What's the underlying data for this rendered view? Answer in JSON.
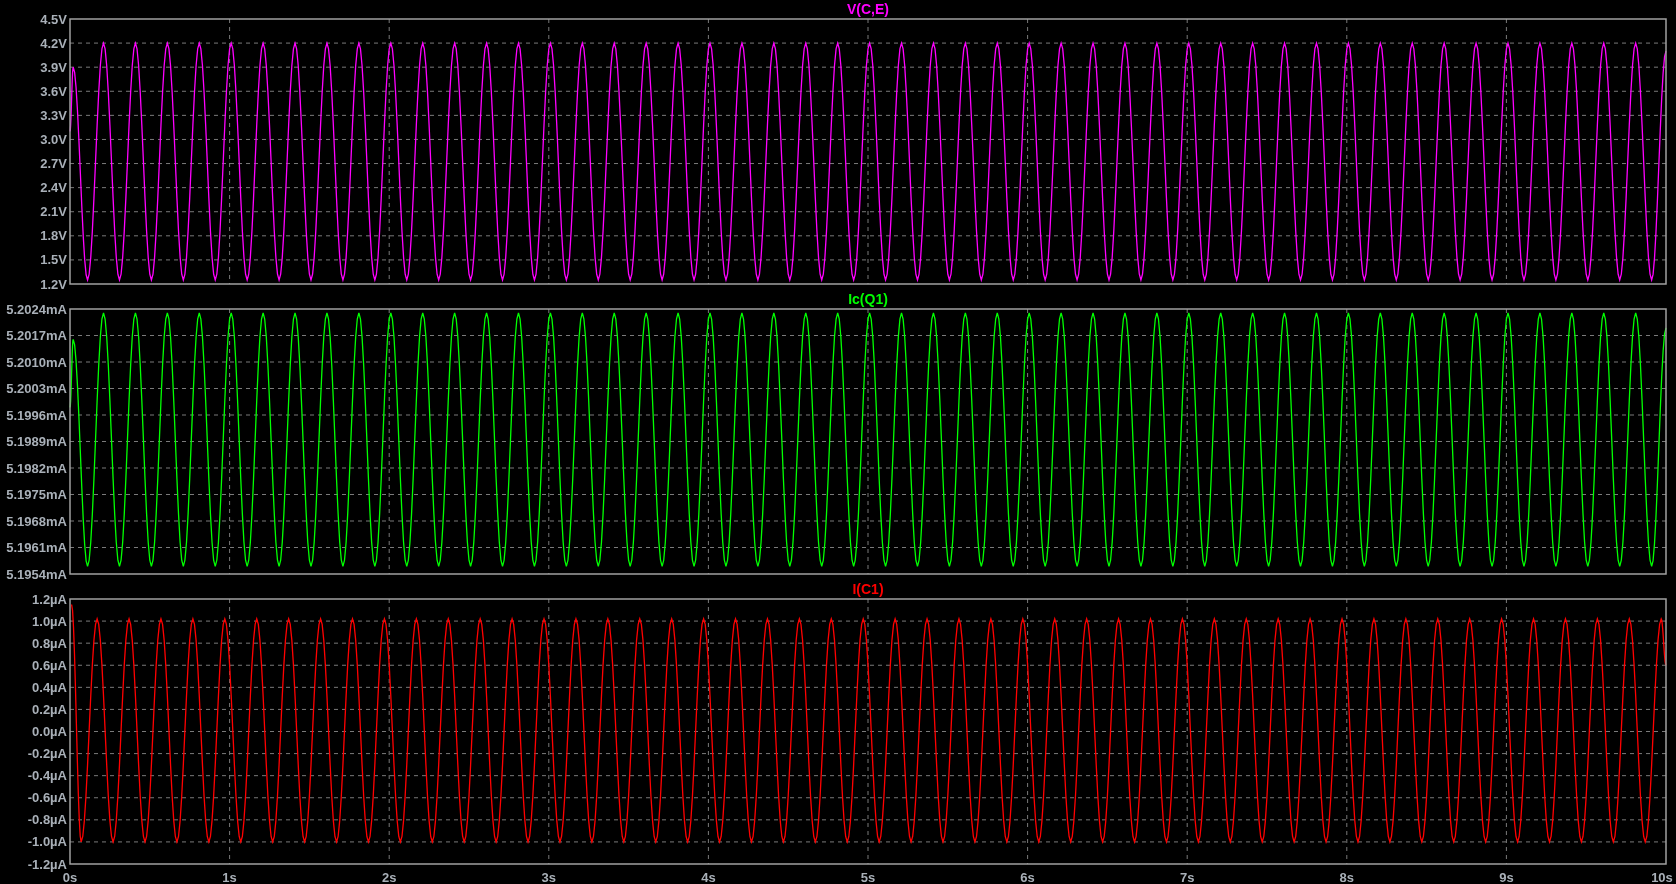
{
  "plots": [
    {
      "chart_data": {
        "type": "line",
        "grid": true,
        "xlim": [
          0,
          10
        ],
        "ylim": [
          1.2,
          4.5
        ],
        "yticks": [
          {
            "value": 4.5,
            "label": "4.5V"
          },
          {
            "value": 4.2,
            "label": "4.2V"
          },
          {
            "value": 3.9,
            "label": "3.9V"
          },
          {
            "value": 3.6,
            "label": "3.6V"
          },
          {
            "value": 3.3,
            "label": "3.3V"
          },
          {
            "value": 3.0,
            "label": "3.0V"
          },
          {
            "value": 2.7,
            "label": "2.7V"
          },
          {
            "value": 2.4,
            "label": "2.4V"
          },
          {
            "value": 2.1,
            "label": "2.1V"
          },
          {
            "value": 1.8,
            "label": "1.8V"
          },
          {
            "value": 1.5,
            "label": "1.5V"
          },
          {
            "value": 1.2,
            "label": "1.2V"
          }
        ],
        "x": [
          0,
          0.02,
          0.11,
          0.21,
          0.31,
          0.41,
          0.51,
          0.61,
          0.71,
          0.81,
          0.91,
          1.01,
          1.11,
          1.21,
          1.31,
          1.41,
          1.51,
          1.61,
          1.71,
          1.81,
          1.91,
          2.01,
          2.11,
          2.21,
          2.31,
          2.41,
          2.51,
          2.61,
          2.71,
          2.81,
          2.91,
          3.01,
          3.11,
          3.21,
          3.31,
          3.41,
          3.51,
          3.61,
          3.71,
          3.81,
          3.91,
          4.01,
          4.11,
          4.21,
          4.31,
          4.41,
          4.51,
          4.61,
          4.71,
          4.81,
          4.91,
          5.01,
          5.11,
          5.21,
          5.31,
          5.41,
          5.51,
          5.61,
          5.71,
          5.81,
          5.91,
          6.01,
          6.11,
          6.21,
          6.31,
          6.41,
          6.51,
          6.61,
          6.71,
          6.81,
          6.91,
          7.01,
          7.11,
          7.21,
          7.31,
          7.41,
          7.51,
          7.61,
          7.71,
          7.81,
          7.91,
          8.01,
          8.11,
          8.21,
          8.31,
          8.41,
          8.51,
          8.61,
          8.71,
          8.81,
          8.91,
          9.01,
          9.11,
          9.21,
          9.31,
          9.41,
          9.51,
          9.61,
          9.71,
          9.81,
          9.91,
          10
        ],
        "series": [
          {
            "name": "V(C,E)",
            "color": "#ff00ff",
            "values": [
              3.1,
              3.9,
              1.25,
              4.2,
              1.25,
              4.2,
              1.25,
              4.2,
              1.25,
              4.2,
              1.25,
              4.2,
              1.25,
              4.2,
              1.25,
              4.2,
              1.25,
              4.2,
              1.25,
              4.2,
              1.25,
              4.2,
              1.25,
              4.2,
              1.25,
              4.2,
              1.25,
              4.2,
              1.25,
              4.2,
              1.25,
              4.2,
              1.25,
              4.2,
              1.25,
              4.2,
              1.25,
              4.2,
              1.25,
              4.2,
              1.25,
              4.2,
              1.25,
              4.2,
              1.25,
              4.2,
              1.25,
              4.2,
              1.25,
              4.2,
              1.25,
              4.2,
              1.25,
              4.2,
              1.25,
              4.2,
              1.25,
              4.2,
              1.25,
              4.2,
              1.25,
              4.2,
              1.25,
              4.2,
              1.25,
              4.2,
              1.25,
              4.2,
              1.25,
              4.2,
              1.25,
              4.2,
              1.25,
              4.2,
              1.25,
              4.2,
              1.25,
              4.2,
              1.25,
              4.2,
              1.25,
              4.2,
              1.25,
              4.2,
              1.25,
              4.2,
              1.25,
              4.2,
              1.25,
              4.2,
              1.25,
              4.2,
              1.25,
              4.2,
              1.25,
              4.2,
              1.25,
              4.2,
              1.25,
              4.2,
              1.25,
              4.1
            ]
          }
        ]
      }
    },
    {
      "chart_data": {
        "type": "line",
        "grid": true,
        "xlim": [
          0,
          10
        ],
        "ylim": [
          5.1954,
          5.2024
        ],
        "yticks": [
          {
            "value": 5.2024,
            "label": "5.2024mA"
          },
          {
            "value": 5.2017,
            "label": "5.2017mA"
          },
          {
            "value": 5.201,
            "label": "5.2010mA"
          },
          {
            "value": 5.2003,
            "label": "5.2003mA"
          },
          {
            "value": 5.1996,
            "label": "5.1996mA"
          },
          {
            "value": 5.1989,
            "label": "5.1989mA"
          },
          {
            "value": 5.1982,
            "label": "5.1982mA"
          },
          {
            "value": 5.1975,
            "label": "5.1975mA"
          },
          {
            "value": 5.1968,
            "label": "5.1968mA"
          },
          {
            "value": 5.1961,
            "label": "5.1961mA"
          },
          {
            "value": 5.1954,
            "label": "5.1954mA"
          }
        ],
        "x": [
          0,
          0.02,
          0.11,
          0.21,
          0.31,
          0.41,
          0.51,
          0.61,
          0.71,
          0.81,
          0.91,
          1.01,
          1.11,
          1.21,
          1.31,
          1.41,
          1.51,
          1.61,
          1.71,
          1.81,
          1.91,
          2.01,
          2.11,
          2.21,
          2.31,
          2.41,
          2.51,
          2.61,
          2.71,
          2.81,
          2.91,
          3.01,
          3.11,
          3.21,
          3.31,
          3.41,
          3.51,
          3.61,
          3.71,
          3.81,
          3.91,
          4.01,
          4.11,
          4.21,
          4.31,
          4.41,
          4.51,
          4.61,
          4.71,
          4.81,
          4.91,
          5.01,
          5.11,
          5.21,
          5.31,
          5.41,
          5.51,
          5.61,
          5.71,
          5.81,
          5.91,
          6.01,
          6.11,
          6.21,
          6.31,
          6.41,
          6.51,
          6.61,
          6.71,
          6.81,
          6.91,
          7.01,
          7.11,
          7.21,
          7.31,
          7.41,
          7.51,
          7.61,
          7.71,
          7.81,
          7.91,
          8.01,
          8.11,
          8.21,
          8.31,
          8.41,
          8.51,
          8.61,
          8.71,
          8.81,
          8.91,
          9.01,
          9.11,
          9.21,
          9.31,
          9.41,
          9.51,
          9.61,
          9.71,
          9.81,
          9.91,
          10
        ],
        "series": [
          {
            "name": "Ic(Q1)",
            "color": "#00ff00",
            "values": [
              5.1998,
              5.2016,
              5.1956,
              5.2023,
              5.1956,
              5.2023,
              5.1956,
              5.2023,
              5.1956,
              5.2023,
              5.1956,
              5.2023,
              5.1956,
              5.2023,
              5.1956,
              5.2023,
              5.1956,
              5.2023,
              5.1956,
              5.2023,
              5.1956,
              5.2023,
              5.1956,
              5.2023,
              5.1956,
              5.2023,
              5.1956,
              5.2023,
              5.1956,
              5.2023,
              5.1956,
              5.2023,
              5.1956,
              5.2023,
              5.1956,
              5.2023,
              5.1956,
              5.2023,
              5.1956,
              5.2023,
              5.1956,
              5.2023,
              5.1956,
              5.2023,
              5.1956,
              5.2023,
              5.1956,
              5.2023,
              5.1956,
              5.2023,
              5.1956,
              5.2023,
              5.1956,
              5.2023,
              5.1956,
              5.2023,
              5.1956,
              5.2023,
              5.1956,
              5.2023,
              5.1956,
              5.2023,
              5.1956,
              5.2023,
              5.1956,
              5.2023,
              5.1956,
              5.2023,
              5.1956,
              5.2023,
              5.1956,
              5.2023,
              5.1956,
              5.2023,
              5.1956,
              5.2023,
              5.1956,
              5.2023,
              5.1956,
              5.2023,
              5.1956,
              5.2023,
              5.1956,
              5.2023,
              5.1956,
              5.2023,
              5.1956,
              5.2023,
              5.1956,
              5.2023,
              5.1956,
              5.2023,
              5.1956,
              5.2023,
              5.1956,
              5.2023,
              5.1956,
              5.2023,
              5.1956,
              5.2023,
              5.1956,
              5.2019
            ]
          }
        ]
      }
    },
    {
      "chart_data": {
        "type": "line",
        "grid": true,
        "xlim": [
          0,
          10
        ],
        "ylim": [
          -1.2,
          1.2
        ],
        "xticks": [
          {
            "value": 0,
            "label": "0s"
          },
          {
            "value": 1,
            "label": "1s"
          },
          {
            "value": 2,
            "label": "2s"
          },
          {
            "value": 3,
            "label": "3s"
          },
          {
            "value": 4,
            "label": "4s"
          },
          {
            "value": 5,
            "label": "5s"
          },
          {
            "value": 6,
            "label": "6s"
          },
          {
            "value": 7,
            "label": "7s"
          },
          {
            "value": 8,
            "label": "8s"
          },
          {
            "value": 9,
            "label": "9s"
          },
          {
            "value": 10,
            "label": "10s"
          }
        ],
        "yticks": [
          {
            "value": 1.2,
            "label": "1.2µA"
          },
          {
            "value": 1.0,
            "label": "1.0µA"
          },
          {
            "value": 0.8,
            "label": "0.8µA"
          },
          {
            "value": 0.6,
            "label": "0.6µA"
          },
          {
            "value": 0.4,
            "label": "0.4µA"
          },
          {
            "value": 0.2,
            "label": "0.2µA"
          },
          {
            "value": 0.0,
            "label": "0.0µA"
          },
          {
            "value": -0.2,
            "label": "-0.2µA"
          },
          {
            "value": -0.4,
            "label": "-0.4µA"
          },
          {
            "value": -0.6,
            "label": "-0.6µA"
          },
          {
            "value": -0.8,
            "label": "-0.8µA"
          },
          {
            "value": -1.0,
            "label": "-1.0µA"
          },
          {
            "value": -1.2,
            "label": "-1.2µA"
          }
        ],
        "x": [
          0.01,
          0.07,
          0.17,
          0.27,
          0.37,
          0.47,
          0.57,
          0.67,
          0.77,
          0.87,
          0.97,
          1.07,
          1.17,
          1.27,
          1.37,
          1.47,
          1.57,
          1.67,
          1.77,
          1.87,
          1.97,
          2.07,
          2.17,
          2.27,
          2.37,
          2.47,
          2.57,
          2.67,
          2.77,
          2.87,
          2.97,
          3.07,
          3.17,
          3.27,
          3.37,
          3.47,
          3.57,
          3.67,
          3.77,
          3.87,
          3.97,
          4.07,
          4.17,
          4.27,
          4.37,
          4.47,
          4.57,
          4.67,
          4.77,
          4.87,
          4.97,
          5.07,
          5.17,
          5.27,
          5.37,
          5.47,
          5.57,
          5.67,
          5.77,
          5.87,
          5.97,
          6.07,
          6.17,
          6.27,
          6.37,
          6.47,
          6.57,
          6.67,
          6.77,
          6.87,
          6.97,
          7.07,
          7.17,
          7.27,
          7.37,
          7.47,
          7.57,
          7.67,
          7.77,
          7.87,
          7.97,
          8.07,
          8.17,
          8.27,
          8.37,
          8.47,
          8.57,
          8.67,
          8.77,
          8.87,
          8.97,
          9.07,
          9.17,
          9.27,
          9.37,
          9.47,
          9.57,
          9.67,
          9.77,
          9.87,
          9.97,
          10
        ],
        "series": [
          {
            "name": "I(C1)",
            "color": "#ff0000",
            "values": [
              1.15,
              -1.0,
              1.02,
              -1.0,
              1.02,
              -1.0,
              1.02,
              -1.0,
              1.02,
              -1.0,
              1.02,
              -1.0,
              1.02,
              -1.0,
              1.02,
              -1.0,
              1.02,
              -1.0,
              1.02,
              -1.0,
              1.02,
              -1.0,
              1.02,
              -1.0,
              1.02,
              -1.0,
              1.02,
              -1.0,
              1.02,
              -1.0,
              1.02,
              -1.0,
              1.02,
              -1.0,
              1.02,
              -1.0,
              1.02,
              -1.0,
              1.02,
              -1.0,
              1.02,
              -1.0,
              1.02,
              -1.0,
              1.02,
              -1.0,
              1.02,
              -1.0,
              1.02,
              -1.0,
              1.02,
              -1.0,
              1.02,
              -1.0,
              1.02,
              -1.0,
              1.02,
              -1.0,
              1.02,
              -1.0,
              1.02,
              -1.0,
              1.02,
              -1.0,
              1.02,
              -1.0,
              1.02,
              -1.0,
              1.02,
              -1.0,
              1.02,
              -1.0,
              1.02,
              -1.0,
              1.02,
              -1.0,
              1.02,
              -1.0,
              1.02,
              -1.0,
              1.02,
              -1.0,
              1.02,
              -1.0,
              1.02,
              -1.0,
              1.02,
              -1.0,
              1.02,
              -1.0,
              1.02,
              -1.0,
              1.02,
              -1.0,
              1.02,
              -1.0,
              1.02,
              -1.0,
              1.02,
              -1.0,
              1.02,
              0.6
            ]
          }
        ]
      }
    }
  ]
}
